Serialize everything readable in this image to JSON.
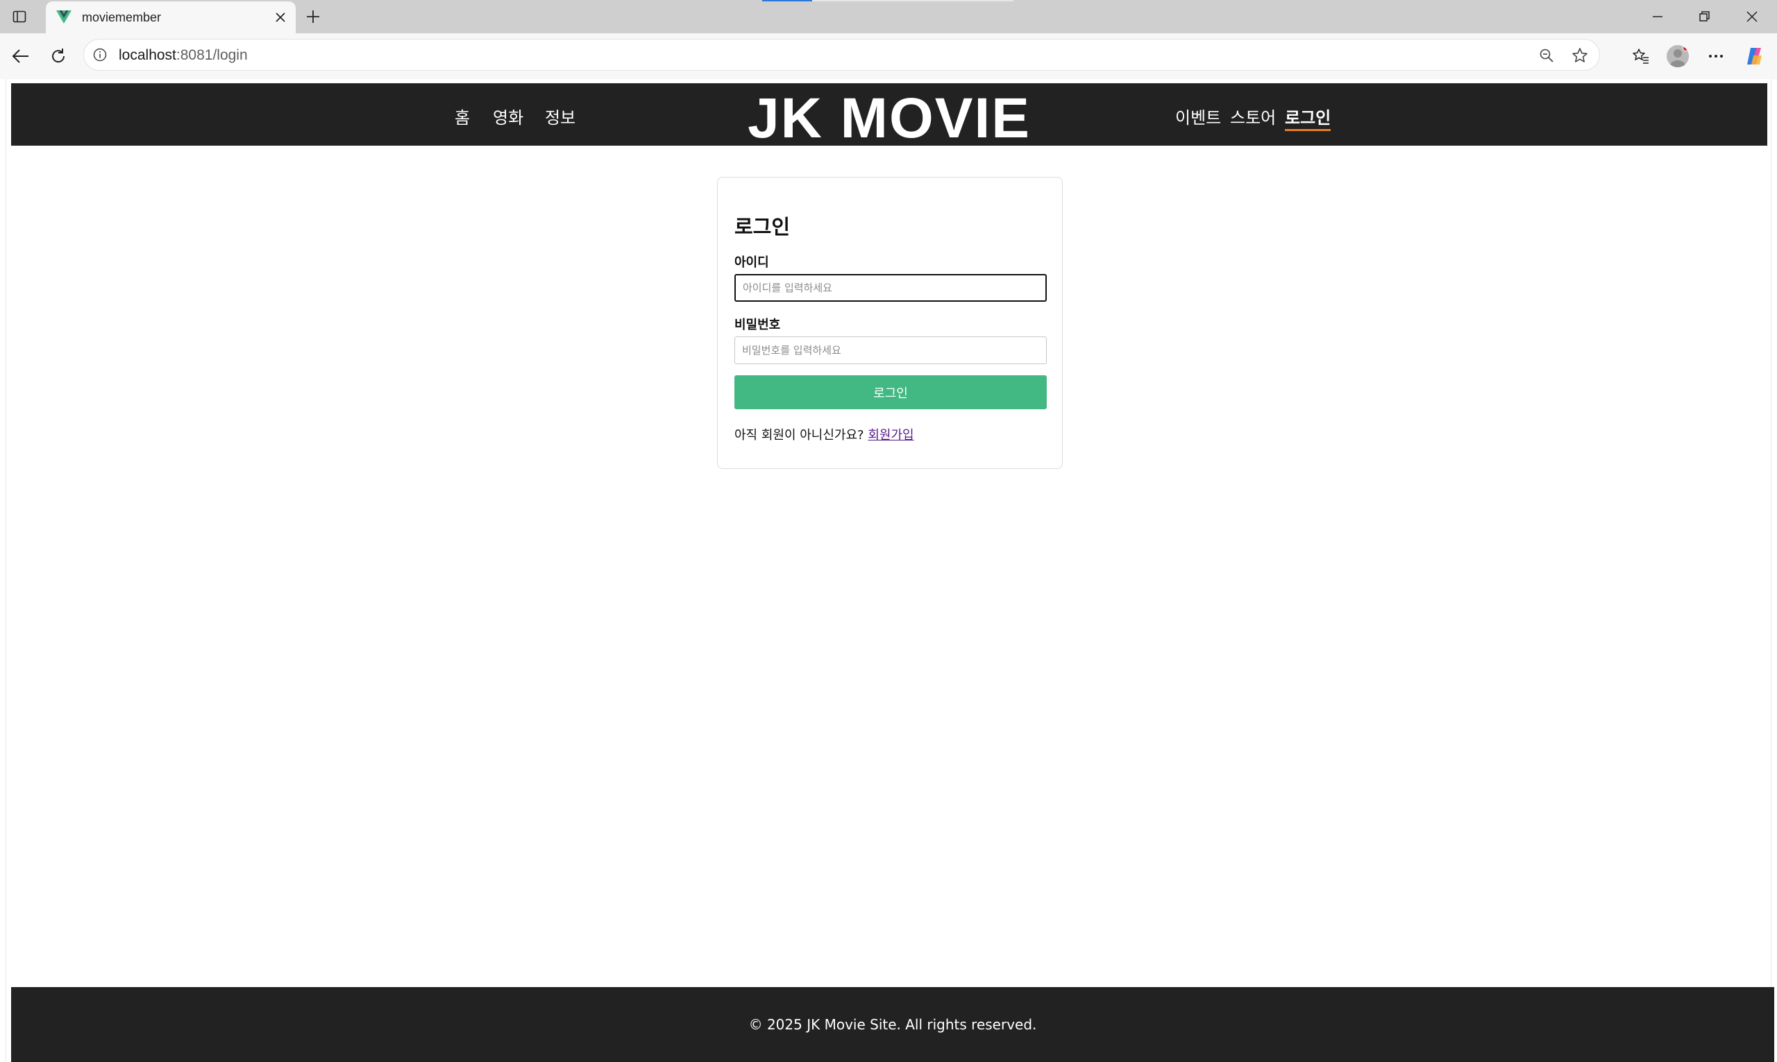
{
  "browser": {
    "tab_title": "moviemember",
    "url_host": "localhost",
    "url_path": ":8081/login"
  },
  "site": {
    "logo": "JK MOVIE",
    "nav_left": [
      "홈",
      "영화",
      "정보"
    ],
    "nav_right": [
      "이벤트",
      "스토어",
      "로그인"
    ],
    "active_nav": "로그인",
    "accent_color": "#42b883",
    "header_bg": "#222222"
  },
  "login": {
    "title": "로그인",
    "id_label": "아이디",
    "id_placeholder": "아이디를 입력하세요",
    "id_value": "",
    "pw_label": "비밀번호",
    "pw_placeholder": "비밀번호를 입력하세요",
    "pw_value": "",
    "submit_label": "로그인",
    "signup_prompt": "아직 회원이 아니신가요?",
    "signup_link": "회원가입"
  },
  "footer": {
    "copyright": "© 2025 JK Movie Site. All rights reserved."
  }
}
